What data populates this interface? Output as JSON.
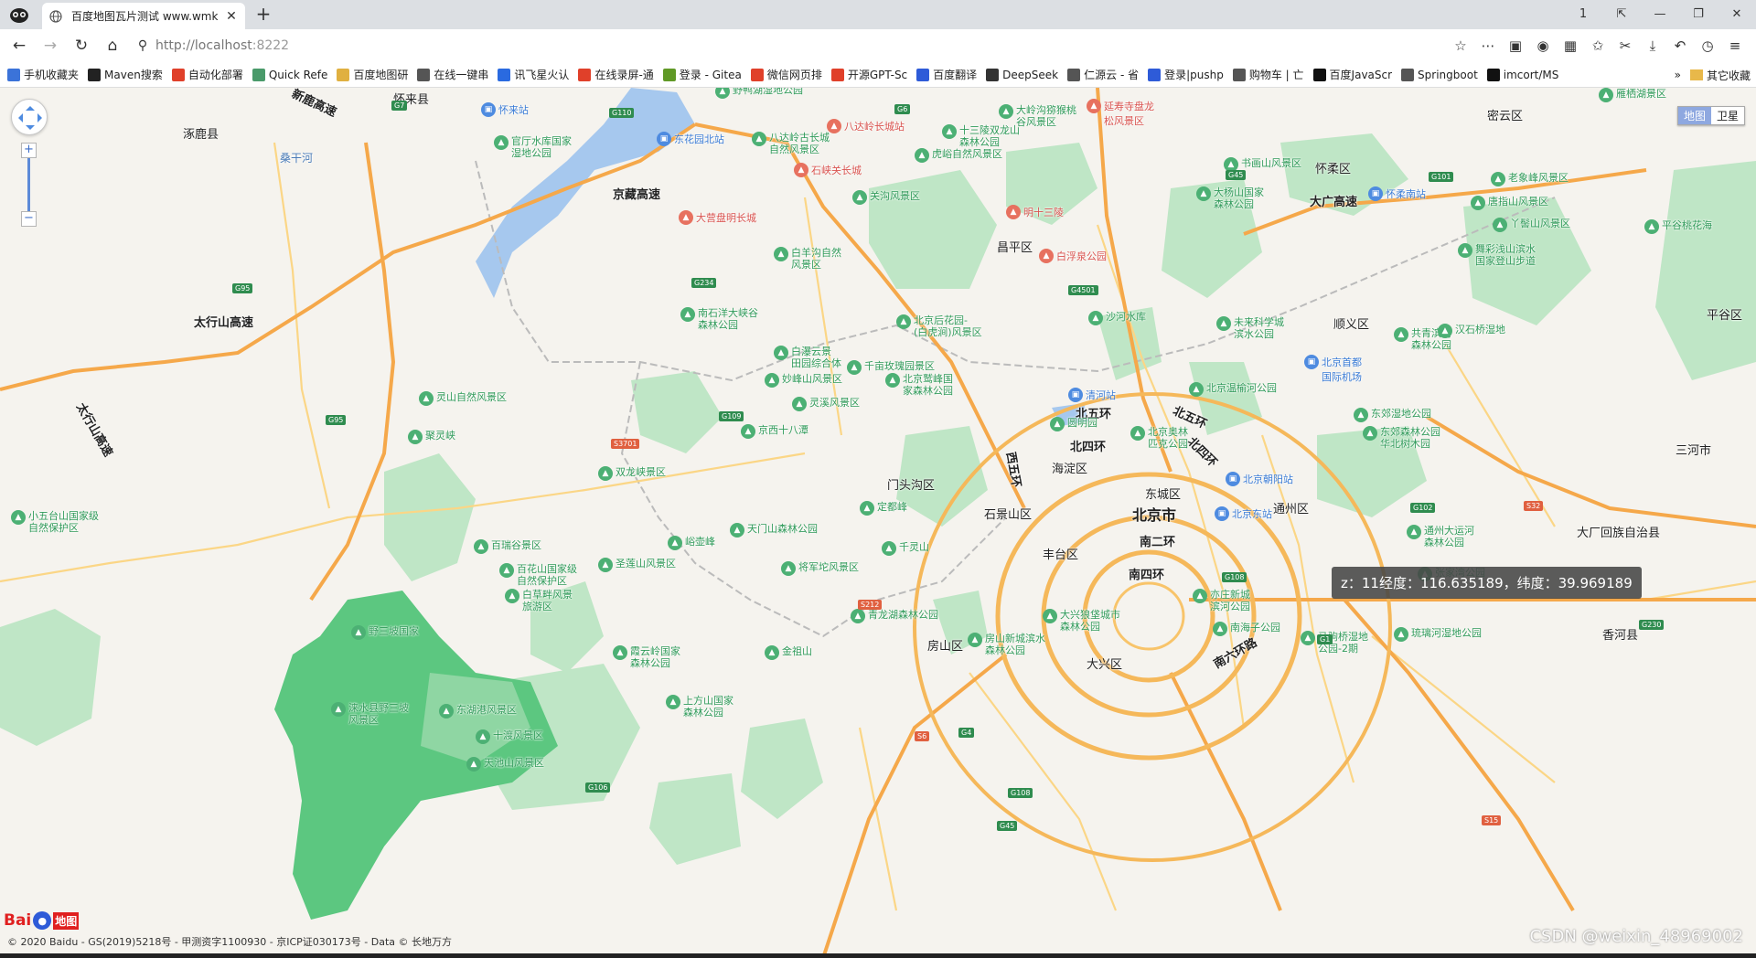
{
  "browser": {
    "tab_title": "百度地图瓦片测试 www.wmk",
    "tab_close": "✕",
    "new_tab": "+",
    "url_host": "http://localhost",
    "url_port": ":8222",
    "window_controls": [
      "1",
      "⇱",
      "—",
      "❐",
      "✕"
    ],
    "bookmarks": [
      {
        "label": "手机收藏夹",
        "color": "#3b73d9"
      },
      {
        "label": "Maven搜索",
        "color": "#222222"
      },
      {
        "label": "自动化部署",
        "color": "#e0402a"
      },
      {
        "label": "Quick Refe",
        "color": "#4a9a6a"
      },
      {
        "label": "百度地图研",
        "color": "#e0b040"
      },
      {
        "label": "在线一键串",
        "color": "#555555"
      },
      {
        "label": "讯飞星火认",
        "color": "#2a6ae0"
      },
      {
        "label": "在线录屏-通",
        "color": "#e0402a"
      },
      {
        "label": "登录 - Gitea",
        "color": "#609926"
      },
      {
        "label": "微信网页排",
        "color": "#e0402a"
      },
      {
        "label": "开源GPT-Sc",
        "color": "#e0402a"
      },
      {
        "label": "百度翻译",
        "color": "#2e5bd8"
      },
      {
        "label": "DeepSeek",
        "color": "#333333"
      },
      {
        "label": "仁源云 - 省",
        "color": "#555555"
      },
      {
        "label": "登录|pushp",
        "color": "#2e5bd8"
      },
      {
        "label": "购物车 | 亡",
        "color": "#555555"
      },
      {
        "label": "百度JavaScr",
        "color": "#111111"
      },
      {
        "label": "Springboot",
        "color": "#555555"
      },
      {
        "label": "imcort/MS",
        "color": "#111111"
      }
    ],
    "bookmarks_more": "»",
    "bookmarks_other": "其它收藏"
  },
  "map": {
    "tooltip": "z：11经度：116.635189，纬度：39.969189",
    "maptype": {
      "map": "地图",
      "satellite": "卫星"
    },
    "logo_text": "Bai",
    "logo_text2": "地图",
    "copyright": "© 2020 Baidu - GS(2019)5218号 - 甲测资字1100930 - 京ICP证030173号 - Data © 长地万方",
    "watermark": "CSDN @weixin_48969002",
    "zoom_in": "+",
    "zoom_out": "−",
    "colors": {
      "green": "#a8dfb4",
      "dark_green": "#5cc780",
      "water": "#a6c8ee",
      "highway": "#f5a84a",
      "road": "#fbd686"
    },
    "labels": {
      "beijing": "北京市",
      "l1": "怀来县",
      "l2": "涿鹿县",
      "l3": "桑干河",
      "l4": "京藏高速",
      "l5": "太行山高速",
      "l6": "太行山高速",
      "l7": "密云区",
      "l8": "怀柔区",
      "l9": "大广高速",
      "l10": "昌平区",
      "l11": "顺义区",
      "l12": "平谷区",
      "l13": "门头沟区",
      "l14": "海淀区",
      "l15": "石景山区",
      "l16": "丰台区",
      "l17": "东城区",
      "l18": "通州区",
      "l19": "南二环",
      "l20": "南四环",
      "l21": "北五环",
      "l22": "北四环",
      "l23": "西五环",
      "l24": "北四环",
      "l25": "北五环",
      "l26": "房山区",
      "l27": "大兴区",
      "l28": "南六环路",
      "l29": "三河市",
      "l30": "大厂回族自治县",
      "l31": "香河县",
      "l32": "新鹿高速"
    },
    "pois_green": [
      "野鸭湖湿地公园",
      "官厅水库国家\n湿地公园",
      "八达岭古长城\n自然风景区",
      "十三陵双龙山\n森林公园",
      "大岭沟猕猴桃\n谷风景区",
      "雁栖湖景区",
      "虎峪自然风景区",
      "书画山风景区",
      "大杨山国家\n森林公园",
      "关沟风景区",
      "白羊沟自然\n风景区",
      "南石洋大峡谷\n森林公园",
      "北京后花园-\n(白虎涧)风景区",
      "沙河水库",
      "未来科学城\n滨水公园",
      "白瀑云景\n田园综合体",
      "千亩玫瑰园景区",
      "妙峰山风景区",
      "北京鹫峰国\n家森林公园",
      "灵山自然风景区",
      "灵溪风景区",
      "京西十八潭",
      "北京温榆河公园",
      "东郊湿地公园",
      "东郊森林公园\n华北树木园",
      "聚灵峡",
      "双龙峡景区",
      "小五台山国家级\n自然保护区",
      "圆明园",
      "北京奥林\n匹克公园",
      "定都峰",
      "天门山森林公园",
      "百瑞谷景区",
      "百花山国家级\n自然保护区",
      "峪壶峰",
      "圣莲山风景区",
      "将军坨风景区",
      "千灵山",
      "白草畔风景\n旅游区",
      "青龙湖森林公园",
      "大兴狼垡城市\n森林公园",
      "亦庄新城\n滨河公园",
      "南海子公园",
      "通州大运河\n森林公园",
      "张家湾公园",
      "马驹桥湿地\n公园-2期",
      "霞云岭国家\n森林公园",
      "金祖山",
      "房山新城滨水\n森林公园",
      "野三坡国家",
      "涞水县野三坡\n风景区",
      "东湖港风景区",
      "上方山国家\n森林公园",
      "十渡风景区",
      "天池山风景区",
      "琉璃河湿地公园",
      "老象峰风景区",
      "唐指山风景区",
      "丫髻山风景区",
      "平谷桃花海",
      "舞彩浅山滨水\n国家登山步道",
      "共青滨河\n森林公园",
      "汉石桥湿地"
    ],
    "pois_red": [
      "延寿寺盘龙\n松风景区",
      "石峡关长城",
      "大营盘明长城",
      "明十三陵",
      "白浮泉公园",
      "八达岭长城站"
    ],
    "pois_blue": [
      "怀来站",
      "东花园北站",
      "怀柔南站",
      "北京首都\n国际机场",
      "清河站",
      "北京朝阳站",
      "北京东站"
    ],
    "shields": [
      "G7",
      "G110",
      "G6",
      "G95",
      "G95",
      "G45",
      "G101",
      "G4501",
      "G108",
      "G234",
      "G109",
      "S3701",
      "S212",
      "G108",
      "G4",
      "G45",
      "S32",
      "G1",
      "G230",
      "G102",
      "S6",
      "G106",
      "S15"
    ]
  }
}
